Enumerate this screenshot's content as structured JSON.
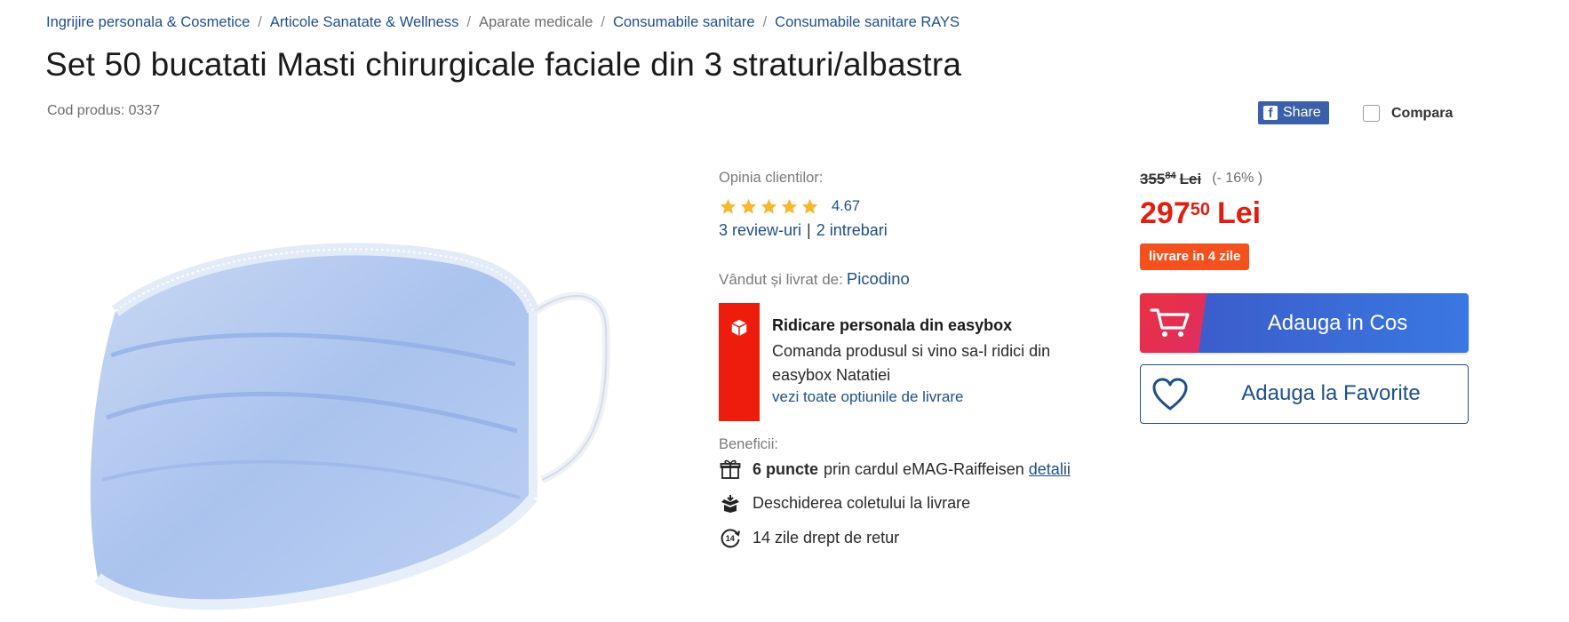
{
  "breadcrumb": {
    "items": [
      "Ingrijire personala & Cosmetice",
      "Articole Sanatate & Wellness",
      "Aparate medicale",
      "Consumabile sanitare",
      "Consumabile sanitare RAYS"
    ],
    "separator": "/"
  },
  "product": {
    "title": "Set 50 bucatati Masti chirurgicale faciale din 3 straturi/albastra",
    "code": "Cod produs: 0337"
  },
  "share": {
    "label": "Share",
    "icon": "facebook-icon",
    "color": "#3b5fa8"
  },
  "compare": {
    "label": "Compara"
  },
  "reviews": {
    "heading": "Opinia clientilor:",
    "rating": "4.67",
    "stars_filled": 5,
    "stars_total": 5,
    "star_color": "#f5b82e",
    "reviews_link": "3 review-uri",
    "questions_link": "2 intrebari",
    "separator": "|"
  },
  "seller": {
    "label": "Vândut și livrat de:",
    "name": "Picodino"
  },
  "easybox": {
    "title": "Ridicare personala din easybox",
    "description": "Comanda produsul si vino sa-l ridici din easybox Natatiei",
    "link": "vezi toate optiunile de livrare",
    "icon": "box-icon",
    "color": "#ee1c0c"
  },
  "benefits": {
    "heading": "Beneficii:",
    "items": [
      {
        "icon": "gift-icon",
        "bold": "6 puncte",
        "text": "prin cardul eMAG-Raiffeisen",
        "link": "detalii"
      },
      {
        "icon": "open-box-icon",
        "text": "Deschiderea coletului la livrare"
      },
      {
        "icon": "return-14-icon",
        "icon_text": "14",
        "text": "14 zile drept de retur"
      }
    ]
  },
  "price": {
    "old_int": "355",
    "old_dec": "84",
    "old_currency": "Lei",
    "discount": "(- 16% )",
    "new_int": "297",
    "new_dec": "50",
    "new_currency": "Lei",
    "price_color": "#e11e12"
  },
  "delivery_badge": {
    "label": "livrare in 4 zile",
    "color": "#f4511e"
  },
  "actions": {
    "add_to_cart": "Adauga in Cos",
    "add_to_favorites": "Adauga la Favorite",
    "cart_color": "#3a6fd8",
    "fav_color": "#1f4f8a"
  }
}
